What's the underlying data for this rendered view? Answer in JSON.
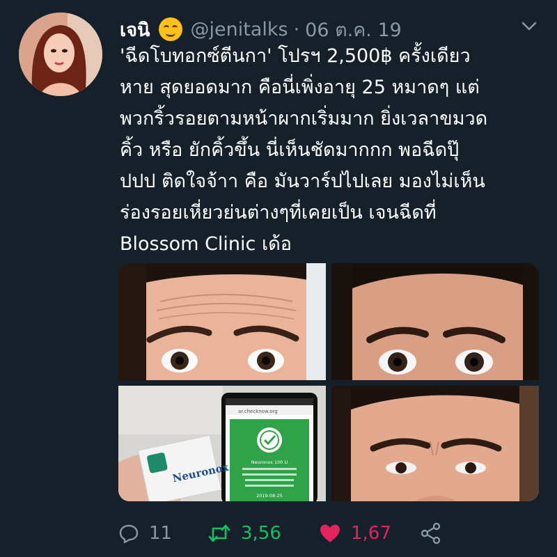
{
  "tweet": {
    "display_name": "เจนิ",
    "emoji": "smiling-face-icon",
    "handle": "@jenitalks",
    "separator": "·",
    "date": "06 ต.ค. 19",
    "text_lines": [
      "'ฉีดโบทอกซ์ตีนกา' โปรฯ 2,500฿ ครั้งเดียว",
      "หาย สุดยอดมาก คือนี่เพิ่งอายุ 25 หมาดๆ แต่",
      "พวกริ้วรอยตามหน้าผากเริ่มมาก ยิ่งเวลาขมวด",
      "คิ้ว หรือ ยักคิ้วขึ้น นี่เห็นชัดมากกก พอฉีดปุ๊",
      "ปปป ติดใจจ้าา คือ มันวาร์ปไปเลย มองไม่เห็น",
      "ร่องรอยเหี่ยวย่นต่างๆที่เคยเป็น เจนฉีดที่",
      "Blossom Clinic เด้อ"
    ],
    "media": {
      "product_box_label": "Neuronox",
      "phone_url": "ar.checknow.org",
      "phone_product": "Neuronox 100 U",
      "phone_date": "2019-08-25"
    },
    "actions": {
      "reply_count": "11",
      "retweet_count": "3,56",
      "like_count": "1,67"
    },
    "colors": {
      "background": "#15202b",
      "secondary_text": "#8899a6",
      "retweet": "#17bf63",
      "like": "#e0245e"
    }
  }
}
